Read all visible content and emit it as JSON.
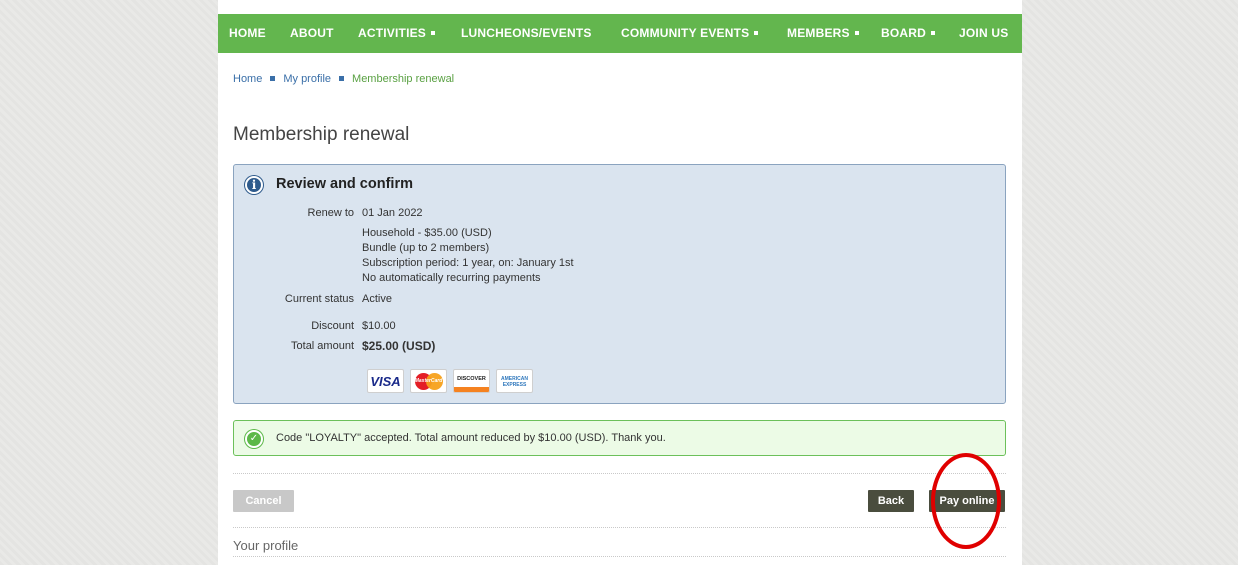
{
  "nav": {
    "items": [
      {
        "label": "HOME",
        "dropdown": false
      },
      {
        "label": "ABOUT",
        "dropdown": false
      },
      {
        "label": "ACTIVITIES",
        "dropdown": true
      },
      {
        "label": "LUNCHEONS/EVENTS",
        "dropdown": false
      },
      {
        "label": "COMMUNITY EVENTS",
        "dropdown": true
      },
      {
        "label": "MEMBERS",
        "dropdown": true
      },
      {
        "label": "BOARD",
        "dropdown": true
      },
      {
        "label": "JOIN US",
        "dropdown": false
      }
    ]
  },
  "breadcrumb": [
    "Home",
    "My profile",
    "Membership renewal"
  ],
  "page_title": "Membership renewal",
  "review": {
    "title": "Review and confirm",
    "renew_to_label": "Renew to",
    "renew_to_value": "01 Jan 2022",
    "plan_lines": [
      "Household - $35.00 (USD)",
      "Bundle (up to 2 members)",
      "Subscription period: 1 year, on: January 1st",
      "No automatically recurring payments"
    ],
    "status_label": "Current status",
    "status_value": "Active",
    "discount_label": "Discount",
    "discount_value": "$10.00",
    "total_label": "Total amount",
    "total_value": "$25.00 (USD)",
    "cards": {
      "visa": "VISA",
      "mastercard": "MasterCard",
      "discover": "DISCOVER",
      "amex": "AMERICAN EXPRESS"
    }
  },
  "success_message": "Code \"LOYALTY\" accepted. Total amount reduced by $10.00 (USD). Thank you.",
  "buttons": {
    "cancel": "Cancel",
    "back": "Back",
    "pay": "Pay online"
  },
  "profile_section_title": "Your profile",
  "colors": {
    "nav_green": "#63b64e",
    "info_bg": "#dae4ef",
    "success_bg": "#ecfbe6",
    "button_dark": "#4a4d3e",
    "annotation_red": "#e00000"
  }
}
